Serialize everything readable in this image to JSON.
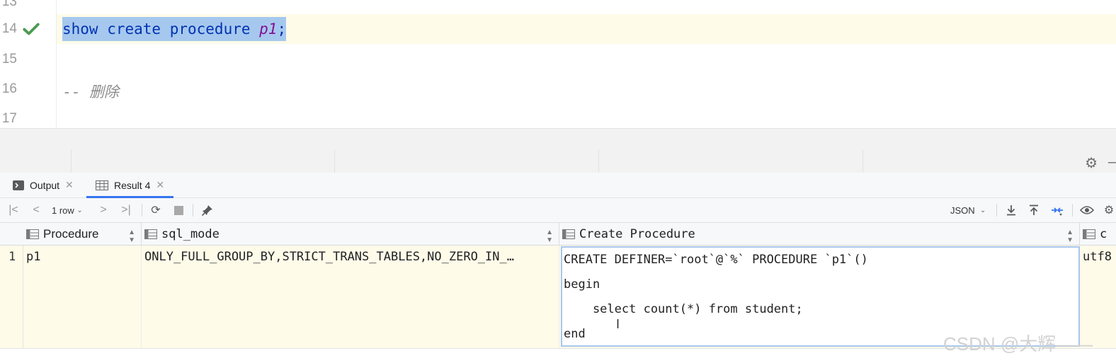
{
  "editor": {
    "line_numbers": [
      "13",
      "14",
      "15",
      "16",
      "17"
    ],
    "statement": {
      "keywords": "show create procedure ",
      "identifier": "p1",
      "terminator": ";"
    },
    "comment": {
      "prefix": "-- ",
      "text": "删除"
    }
  },
  "tabs": [
    {
      "label": "Output",
      "icon": "console-icon"
    },
    {
      "label": "Result 4",
      "icon": "table-icon"
    }
  ],
  "toolbar": {
    "rows_label": "1 row",
    "format_label": "JSON"
  },
  "grid": {
    "columns": [
      "Procedure",
      "sql_mode",
      "Create Procedure",
      "c"
    ],
    "row": {
      "number": "1",
      "procedure": "p1",
      "sql_mode": "ONLY_FULL_GROUP_BY,STRICT_TRANS_TABLES,NO_ZERO_IN_…",
      "create_procedure_lines": [
        "CREATE DEFINER=`root`@`%` PROCEDURE `p1`()",
        "begin",
        "    select count(*) from student;",
        "end"
      ],
      "charset": "utf8"
    }
  },
  "watermark": "CSDN @大辉——",
  "colors": {
    "selection": "#a6c8ee",
    "keyword": "#0033b3",
    "accent": "#3574f0",
    "row_highlight": "#fefbe9"
  }
}
